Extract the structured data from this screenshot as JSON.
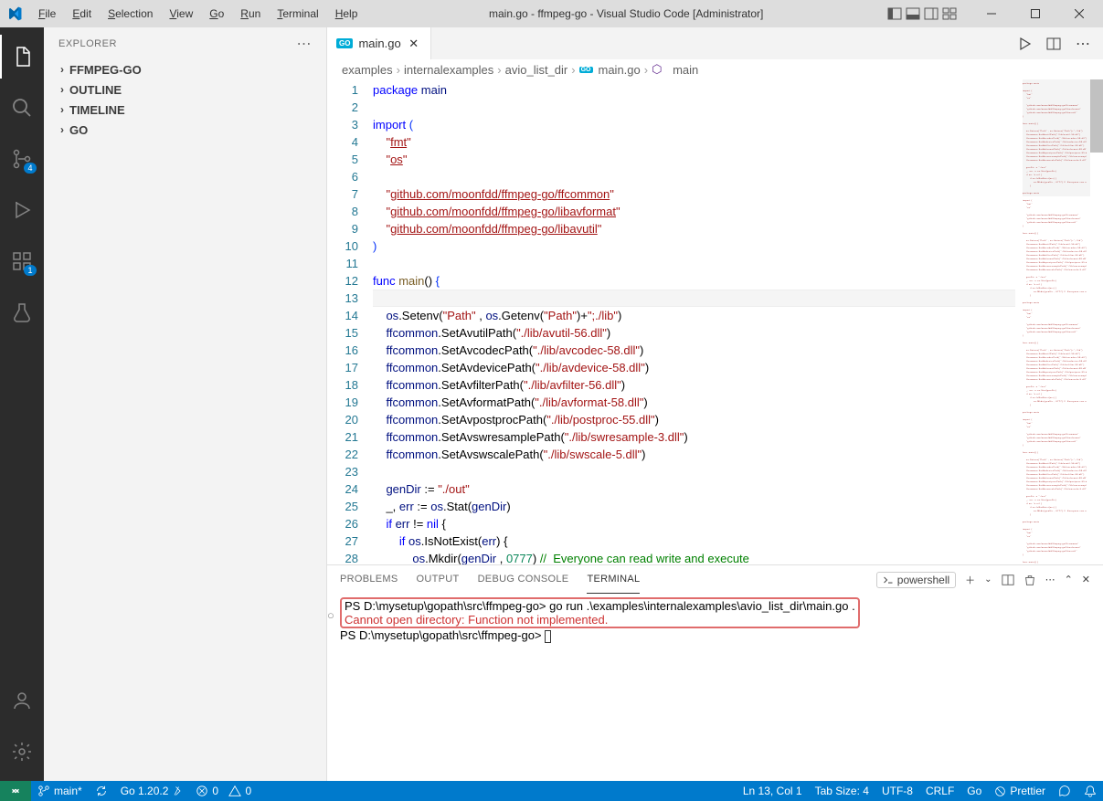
{
  "window": {
    "title": "main.go - ffmpeg-go - Visual Studio Code [Administrator]"
  },
  "menu": [
    "File",
    "Edit",
    "Selection",
    "View",
    "Go",
    "Run",
    "Terminal",
    "Help"
  ],
  "sidebar": {
    "title": "EXPLORER",
    "items": [
      "FFMPEG-GO",
      "OUTLINE",
      "TIMELINE",
      "GO"
    ]
  },
  "badges": {
    "scm": "4",
    "ext": "1"
  },
  "tab": {
    "label": "main.go"
  },
  "breadcrumbs": [
    "examples",
    "internalexamples",
    "avio_list_dir",
    "main.go",
    "main"
  ],
  "code": {
    "1": [
      [
        "kw",
        "package "
      ],
      [
        "id",
        "main"
      ]
    ],
    "2": [
      [
        "",
        ""
      ]
    ],
    "3": [
      [
        "kw",
        "import "
      ],
      [
        "pn",
        "("
      ]
    ],
    "4": [
      [
        "",
        "    "
      ],
      [
        "str",
        "\""
      ],
      [
        "strU",
        "fmt"
      ],
      [
        "str",
        "\""
      ]
    ],
    "5": [
      [
        "",
        "    "
      ],
      [
        "str",
        "\""
      ],
      [
        "strU",
        "os"
      ],
      [
        "str",
        "\""
      ]
    ],
    "6": [
      [
        "",
        ""
      ]
    ],
    "7": [
      [
        "",
        "    "
      ],
      [
        "str",
        "\""
      ],
      [
        "strU",
        "github.com/moonfdd/ffmpeg-go/ffcommon"
      ],
      [
        "str",
        "\""
      ]
    ],
    "8": [
      [
        "",
        "    "
      ],
      [
        "str",
        "\""
      ],
      [
        "strU",
        "github.com/moonfdd/ffmpeg-go/libavformat"
      ],
      [
        "str",
        "\""
      ]
    ],
    "9": [
      [
        "",
        "    "
      ],
      [
        "str",
        "\""
      ],
      [
        "strU",
        "github.com/moonfdd/ffmpeg-go/libavutil"
      ],
      [
        "str",
        "\""
      ]
    ],
    "10": [
      [
        "pn",
        ")"
      ]
    ],
    "11": [
      [
        "",
        ""
      ]
    ],
    "12": [
      [
        "kw",
        "func "
      ],
      [
        "fn",
        "main"
      ],
      [
        "",
        "() "
      ],
      [
        "pn",
        "{"
      ]
    ],
    "13": [
      [
        "",
        ""
      ]
    ],
    "14": [
      [
        "",
        "    "
      ],
      [
        "id",
        "os"
      ],
      [
        "",
        ".Setenv("
      ],
      [
        "str",
        "\"Path\""
      ],
      [
        "",
        " , "
      ],
      [
        "id",
        "os"
      ],
      [
        "",
        ".Getenv("
      ],
      [
        "str",
        "\"Path\""
      ],
      [
        "",
        ")+"
      ],
      [
        "str",
        "\";./lib\""
      ],
      [
        "",
        ")"
      ]
    ],
    "15": [
      [
        "",
        "    "
      ],
      [
        "id",
        "ffcommon"
      ],
      [
        "",
        ".SetAvutilPath("
      ],
      [
        "str",
        "\"./lib/avutil-56.dll\""
      ],
      [
        "",
        ")"
      ]
    ],
    "16": [
      [
        "",
        "    "
      ],
      [
        "id",
        "ffcommon"
      ],
      [
        "",
        ".SetAvcodecPath("
      ],
      [
        "str",
        "\"./lib/avcodec-58.dll\""
      ],
      [
        "",
        ")"
      ]
    ],
    "17": [
      [
        "",
        "    "
      ],
      [
        "id",
        "ffcommon"
      ],
      [
        "",
        ".SetAvdevicePath("
      ],
      [
        "str",
        "\"./lib/avdevice-58.dll\""
      ],
      [
        "",
        ")"
      ]
    ],
    "18": [
      [
        "",
        "    "
      ],
      [
        "id",
        "ffcommon"
      ],
      [
        "",
        ".SetAvfilterPath("
      ],
      [
        "str",
        "\"./lib/avfilter-56.dll\""
      ],
      [
        "",
        ")"
      ]
    ],
    "19": [
      [
        "",
        "    "
      ],
      [
        "id",
        "ffcommon"
      ],
      [
        "",
        ".SetAvformatPath("
      ],
      [
        "str",
        "\"./lib/avformat-58.dll\""
      ],
      [
        "",
        ")"
      ]
    ],
    "20": [
      [
        "",
        "    "
      ],
      [
        "id",
        "ffcommon"
      ],
      [
        "",
        ".SetAvpostprocPath("
      ],
      [
        "str",
        "\"./lib/postproc-55.dll\""
      ],
      [
        "",
        ")"
      ]
    ],
    "21": [
      [
        "",
        "    "
      ],
      [
        "id",
        "ffcommon"
      ],
      [
        "",
        ".SetAvswresamplePath("
      ],
      [
        "str",
        "\"./lib/swresample-3.dll\""
      ],
      [
        "",
        ")"
      ]
    ],
    "22": [
      [
        "",
        "    "
      ],
      [
        "id",
        "ffcommon"
      ],
      [
        "",
        ".SetAvswscalePath("
      ],
      [
        "str",
        "\"./lib/swscale-5.dll\""
      ],
      [
        "",
        ")"
      ]
    ],
    "23": [
      [
        "",
        ""
      ]
    ],
    "24": [
      [
        "",
        "    "
      ],
      [
        "id",
        "genDir"
      ],
      [
        "",
        " := "
      ],
      [
        "str",
        "\"./out\""
      ]
    ],
    "25": [
      [
        "",
        "    _, "
      ],
      [
        "id",
        "err"
      ],
      [
        "",
        " := "
      ],
      [
        "id",
        "os"
      ],
      [
        "",
        ".Stat("
      ],
      [
        "id",
        "genDir"
      ],
      [
        "",
        ")"
      ]
    ],
    "26": [
      [
        "",
        "    "
      ],
      [
        "kw",
        "if "
      ],
      [
        "id",
        "err"
      ],
      [
        "",
        " != "
      ],
      [
        "kw",
        "nil"
      ],
      [
        "",
        " {"
      ]
    ],
    "27": [
      [
        "",
        "        "
      ],
      [
        "kw",
        "if "
      ],
      [
        "id",
        "os"
      ],
      [
        "",
        ".IsNotExist("
      ],
      [
        "id",
        "err"
      ],
      [
        "",
        ") {"
      ]
    ],
    "28": [
      [
        "",
        "            "
      ],
      [
        "id",
        "os"
      ],
      [
        "",
        ".Mkdir("
      ],
      [
        "id",
        "genDir"
      ],
      [
        "",
        " , "
      ],
      [
        "num",
        "0777"
      ],
      [
        "",
        ") "
      ],
      [
        "cmt",
        "//  Everyone can read write and execute"
      ]
    ],
    "29": [
      [
        "",
        "        }"
      ]
    ]
  },
  "panel": {
    "tabs": [
      "PROBLEMS",
      "OUTPUT",
      "DEBUG CONSOLE",
      "TERMINAL"
    ],
    "active": 3,
    "shell": "powershell",
    "lines": {
      "l1a": "PS D:\\mysetup\\gopath\\src\\ffmpeg-go> ",
      "l1b": "go run .\\examples\\internalexamples\\avio_list_dir\\main.go .",
      "l2": "Cannot open directory: Function not implemented.",
      "l3": "PS D:\\mysetup\\gopath\\src\\ffmpeg-go> "
    }
  },
  "status": {
    "branch": "main*",
    "go": "Go 1.20.2",
    "errors": "0",
    "warnings": "0",
    "pos": "Ln 13, Col 1",
    "tab": "Tab Size: 4",
    "enc": "UTF-8",
    "eol": "CRLF",
    "lang": "Go",
    "prettier": "Prettier"
  }
}
